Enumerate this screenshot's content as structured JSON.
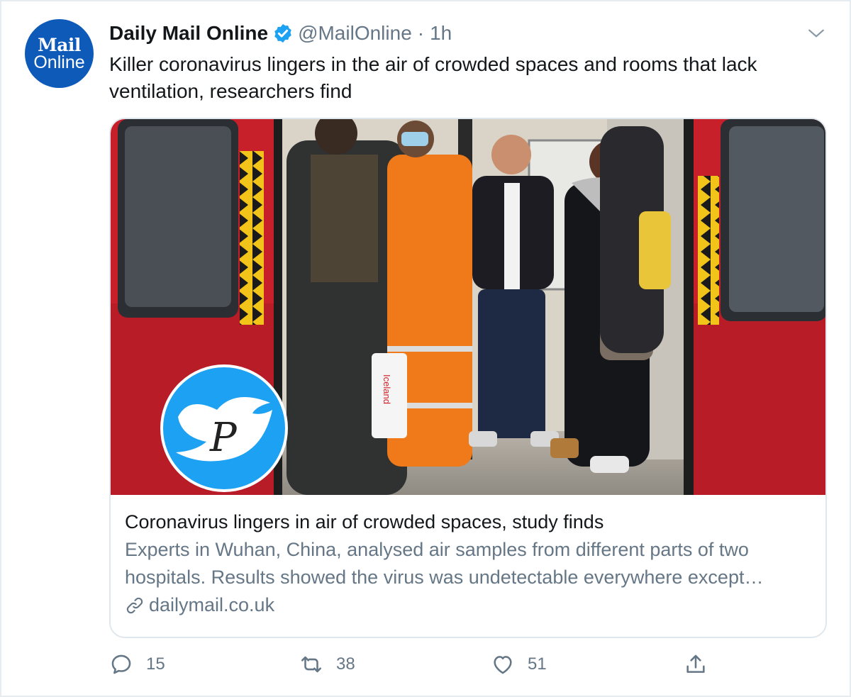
{
  "account": {
    "avatar_line1": "Mail",
    "avatar_line2": "Online",
    "name": "Daily Mail Online",
    "handle": "@MailOnline",
    "separator": "·",
    "time": "1h",
    "verified_icon": "verified-badge-icon",
    "menu_icon": "chevron-down-icon"
  },
  "tweet": {
    "text": "Killer coronavirus lingers in the air of crowded spaces and rooms that lack ventilation, researchers find"
  },
  "card": {
    "image_bag_text": "Iceland",
    "watermark_letter": "P",
    "title": "Coronavirus lingers in air of crowded spaces, study finds",
    "description": "Experts in Wuhan, China, analysed air samples from different parts of two hospitals. Results showed the virus was undetectable everywhere except…",
    "domain": "dailymail.co.uk",
    "link_icon": "link-icon"
  },
  "actions": {
    "reply_count": "15",
    "retweet_count": "38",
    "like_count": "51",
    "icons": [
      "reply-icon",
      "retweet-icon",
      "like-icon",
      "share-icon"
    ]
  },
  "colors": {
    "twitter_blue": "#1da1f2",
    "mail_blue": "#0d5ab9",
    "secondary_text": "#657786",
    "train_red": "#c8202b"
  }
}
